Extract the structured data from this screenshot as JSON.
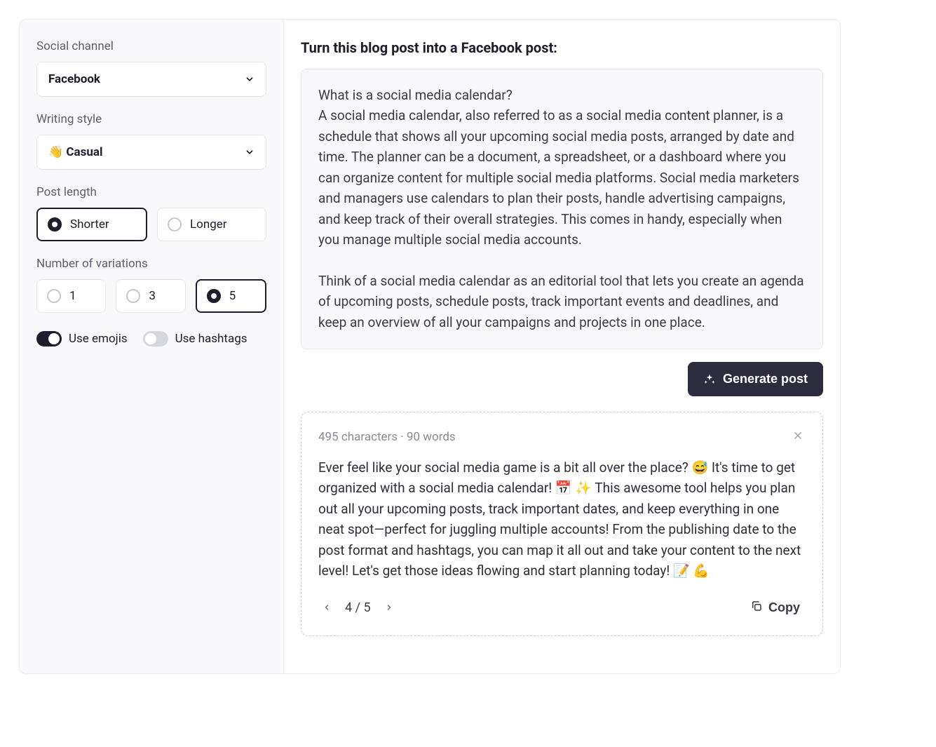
{
  "sidebar": {
    "social_channel": {
      "label": "Social channel",
      "value": "Facebook"
    },
    "writing_style": {
      "label": "Writing style",
      "emoji": "👋",
      "value": "Casual"
    },
    "post_length": {
      "label": "Post length",
      "options": [
        "Shorter",
        "Longer"
      ],
      "selected": "Shorter"
    },
    "variations": {
      "label": "Number of variations",
      "options": [
        "1",
        "3",
        "5"
      ],
      "selected": "5"
    },
    "toggles": {
      "emojis": {
        "label": "Use emojis",
        "on": true
      },
      "hashtags": {
        "label": "Use hashtags",
        "on": false
      }
    }
  },
  "main": {
    "title": "Turn this blog post into a Facebook post:",
    "input_text": "What is a social media calendar?\nA social media calendar, also referred to as a social media content planner, is a schedule that shows all your upcoming social media posts, arranged by date and time. The planner can be a document, a spreadsheet, or a dashboard where you can organize content for multiple social media platforms. Social media marketers and managers use calendars to plan their posts, handle advertising campaigns, and keep track of their overall strategies. This comes in handy, especially when you manage multiple social media accounts.\n\nThink of a social media calendar as an editorial tool that lets you create an agenda of upcoming posts, schedule posts, track important events and deadlines, and keep an overview of all your campaigns and projects in one place.",
    "generate_label": "Generate post",
    "result": {
      "meta": "495 characters · 90 words",
      "text": "Ever feel like your social media game is a bit all over the place? 😅 It's time to get organized with a social media calendar! 📅 ✨ This awesome tool helps you plan out all your upcoming posts, track important dates, and keep everything in one neat spot—perfect for juggling multiple accounts! From the publishing date to the post format and hashtags, you can map it all out and take your content to the next level! Let's get those ideas flowing and start planning today! 📝 💪",
      "page_current": "4",
      "page_total": "5",
      "copy_label": "Copy"
    }
  }
}
